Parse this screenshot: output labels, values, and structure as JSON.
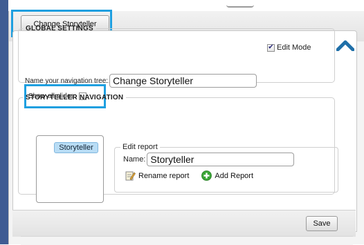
{
  "toolbar": {
    "change_button_label": "Change Storyteller"
  },
  "edit_mode": {
    "label": "Edit Mode",
    "checked": true
  },
  "global_settings": {
    "legend": "GLOBAL SETTINGS",
    "tree_name_label": "Name your navigation tree:",
    "tree_name_value": "Change Storyteller",
    "show_all_slides_label": "Show all slides:"
  },
  "storyteller_navigation": {
    "legend": "STORYTELLER NAVIGATION",
    "tree_items": [
      {
        "label": "Storyteller"
      }
    ],
    "edit_report": {
      "legend": "Edit report",
      "name_label": "Name:",
      "name_value": "Storyteller",
      "rename_label": "Rename report",
      "add_label": "Add Report"
    }
  },
  "footer": {
    "save_label": "Save"
  },
  "colors": {
    "highlight": "#1e9fe0",
    "accent_blue": "#1f6fa8",
    "add_green": "#3aa535",
    "selected_item": "#b9ddf5"
  }
}
